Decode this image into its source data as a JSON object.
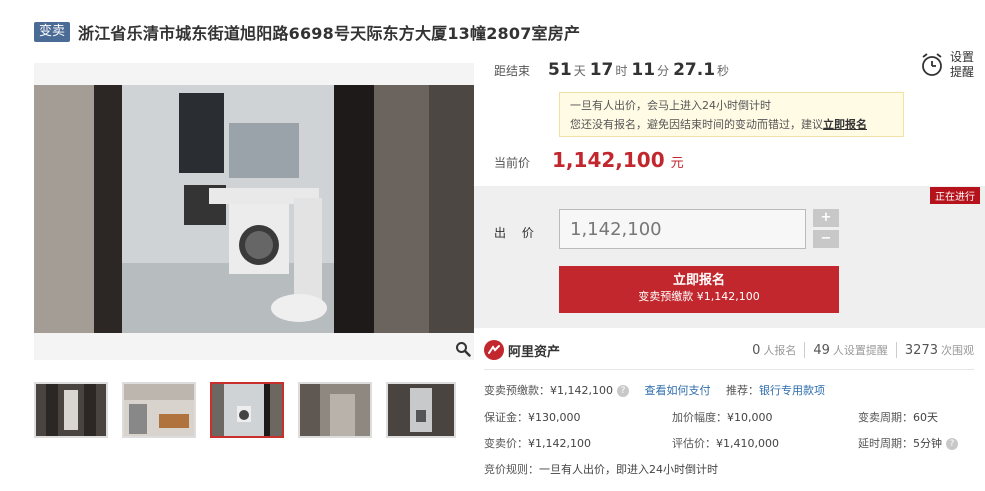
{
  "header": {
    "tag": "变卖",
    "title": "浙江省乐清市城东街道旭阳路6698号天际东方大厦13幢2807室房产"
  },
  "countdown": {
    "label": "距结束",
    "days": "51",
    "days_unit": "天",
    "hours": "17",
    "hours_unit": "时",
    "minutes": "11",
    "minutes_unit": "分",
    "seconds": "27.1",
    "seconds_unit": "秒"
  },
  "remind": {
    "line1": "设置",
    "line2": "提醒"
  },
  "notice": {
    "line1": "一旦有人出价，会马上进入24小时倒计时",
    "line2_prefix": "您还没有报名，避免因结束时间的变动而错过，建议",
    "line2_link": "立即报名"
  },
  "current_price": {
    "label": "当前价",
    "value": "1,142,100",
    "unit": "元"
  },
  "bid": {
    "status_badge": "正在进行",
    "label": "出 价",
    "input_value": "1,142,100",
    "plus": "+",
    "minus": "−",
    "button_main": "立即报名",
    "button_sub": "变卖预缴款 ¥1,142,100"
  },
  "stats": {
    "brand": "阿里资产",
    "signups": "0",
    "signups_label": "人报名",
    "reminders": "49",
    "reminders_label": "人设置提醒",
    "views": "3273",
    "views_label": "次围观"
  },
  "info": {
    "deposit_label": "变卖预缴款：",
    "deposit_value": "¥1,142,100",
    "how_to_pay": "查看如何支付",
    "recommend_label": "推荐：",
    "recommend_link": "银行专用款项",
    "security_label": "保证金：",
    "security_value": "¥130,000",
    "increment_label": "加价幅度：",
    "increment_value": "¥10,000",
    "period_label": "变卖周期：",
    "period_value": "60天",
    "sale_price_label": "变卖价：",
    "sale_price_value": "¥1,142,100",
    "appraisal_label": "评估价：",
    "appraisal_value": "¥1,410,000",
    "delay_label": "延时周期：",
    "delay_value": "5分钟",
    "rules_label": "竞价规则：",
    "rules_value": "一旦有人出价，即进入24小时倒计时"
  },
  "colors": {
    "accent_red": "#c1272d",
    "tag_blue": "#4a6b96",
    "link_blue": "#2f6dab"
  },
  "icons": [
    "alarm-clock-icon",
    "zoom-icon",
    "ali-assets-logo-icon",
    "help-icon"
  ]
}
